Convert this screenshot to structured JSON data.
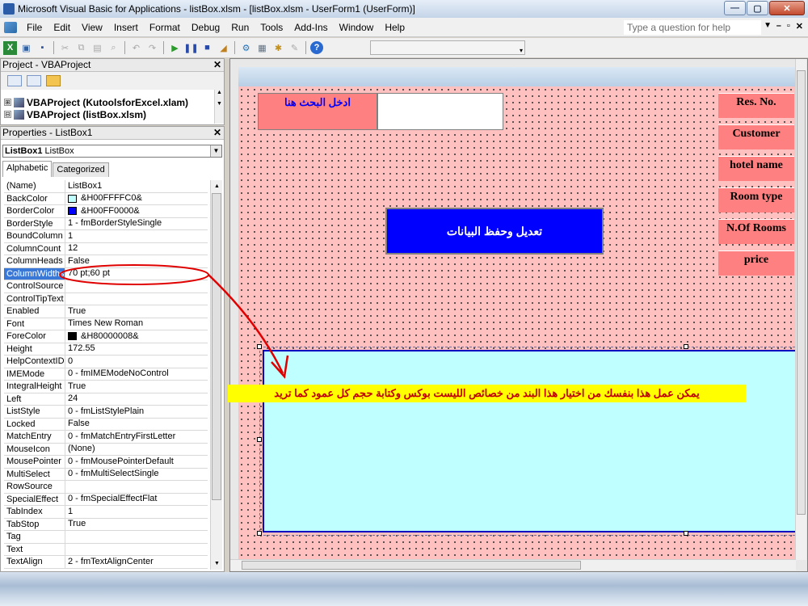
{
  "window": {
    "title": "Microsoft Visual Basic for Applications - listBox.xlsm - [listBox.xlsm - UserForm1 (UserForm)]",
    "min": "—",
    "max": "▢",
    "close": "✕"
  },
  "menu": {
    "items": [
      "File",
      "Edit",
      "View",
      "Insert",
      "Format",
      "Debug",
      "Run",
      "Tools",
      "Add-Ins",
      "Window",
      "Help"
    ],
    "help_placeholder": "Type a question for help",
    "mdi_min": "–",
    "mdi_restore": "▫",
    "mdi_close": "✕"
  },
  "project": {
    "header": "Project - VBAProject",
    "close": "✕",
    "tree": [
      {
        "toggle": "⊞",
        "label": "VBAProject (KutoolsforExcel.xlam)"
      },
      {
        "toggle": "⊟",
        "label": "VBAProject (listBox.xlsm)"
      }
    ]
  },
  "properties": {
    "header": "Properties - ListBox1",
    "close": "✕",
    "object_name": "ListBox1",
    "object_type": "ListBox",
    "tab_alphabetic": "Alphabetic",
    "tab_categorized": "Categorized",
    "rows": [
      {
        "key": "(Name)",
        "value": "ListBox1"
      },
      {
        "key": "BackColor",
        "value": "&H00FFFFC0&",
        "swatch": "#c0ffff"
      },
      {
        "key": "BorderColor",
        "value": "&H00FF0000&",
        "swatch": "#0000ff"
      },
      {
        "key": "BorderStyle",
        "value": "1 - fmBorderStyleSingle"
      },
      {
        "key": "BoundColumn",
        "value": "1"
      },
      {
        "key": "ColumnCount",
        "value": "12"
      },
      {
        "key": "ColumnHeads",
        "value": "False"
      },
      {
        "key": "ColumnWidths",
        "value": "70 pt;60 pt",
        "selected": true
      },
      {
        "key": "ControlSource",
        "value": ""
      },
      {
        "key": "ControlTipText",
        "value": ""
      },
      {
        "key": "Enabled",
        "value": "True"
      },
      {
        "key": "Font",
        "value": "Times New Roman"
      },
      {
        "key": "ForeColor",
        "value": "&H80000008&",
        "swatch": "#000000"
      },
      {
        "key": "Height",
        "value": "172.55"
      },
      {
        "key": "HelpContextID",
        "value": "0"
      },
      {
        "key": "IMEMode",
        "value": "0 - fmIMEModeNoControl"
      },
      {
        "key": "IntegralHeight",
        "value": "True"
      },
      {
        "key": "Left",
        "value": "24"
      },
      {
        "key": "ListStyle",
        "value": "0 - fmListStylePlain"
      },
      {
        "key": "Locked",
        "value": "False"
      },
      {
        "key": "MatchEntry",
        "value": "0 - fmMatchEntryFirstLetter"
      },
      {
        "key": "MouseIcon",
        "value": "(None)"
      },
      {
        "key": "MousePointer",
        "value": "0 - fmMousePointerDefault"
      },
      {
        "key": "MultiSelect",
        "value": "0 - fmMultiSelectSingle"
      },
      {
        "key": "RowSource",
        "value": ""
      },
      {
        "key": "SpecialEffect",
        "value": "0 - fmSpecialEffectFlat"
      },
      {
        "key": "TabIndex",
        "value": "1"
      },
      {
        "key": "TabStop",
        "value": "True"
      },
      {
        "key": "Tag",
        "value": ""
      },
      {
        "key": "Text",
        "value": ""
      },
      {
        "key": "TextAlign",
        "value": "2 - fmTextAlignCenter"
      }
    ]
  },
  "userform": {
    "search_label": "ادخل البحث هنا",
    "save_button": "تعديل وحفظ البيانات",
    "column_labels": [
      "Res. No.",
      "Customer",
      "hotel name",
      "Room type",
      "N.Of Rooms",
      "price"
    ],
    "listbox_backcolor": "#c0ffff",
    "listbox_bordercolor": "#0000ff"
  },
  "annotation": {
    "text": "يمكن عمل هذا بنفسك من اختيار هذا البند من خصائص الليست بوكس وكتابة حجم كل عمود كما تريد",
    "color": "#c00000",
    "background": "#ffff00"
  },
  "colors": {
    "form_back": "#ffc0c0",
    "label_back": "#ff8080",
    "button_back": "#0000ff",
    "selection": "#3a78d8"
  }
}
